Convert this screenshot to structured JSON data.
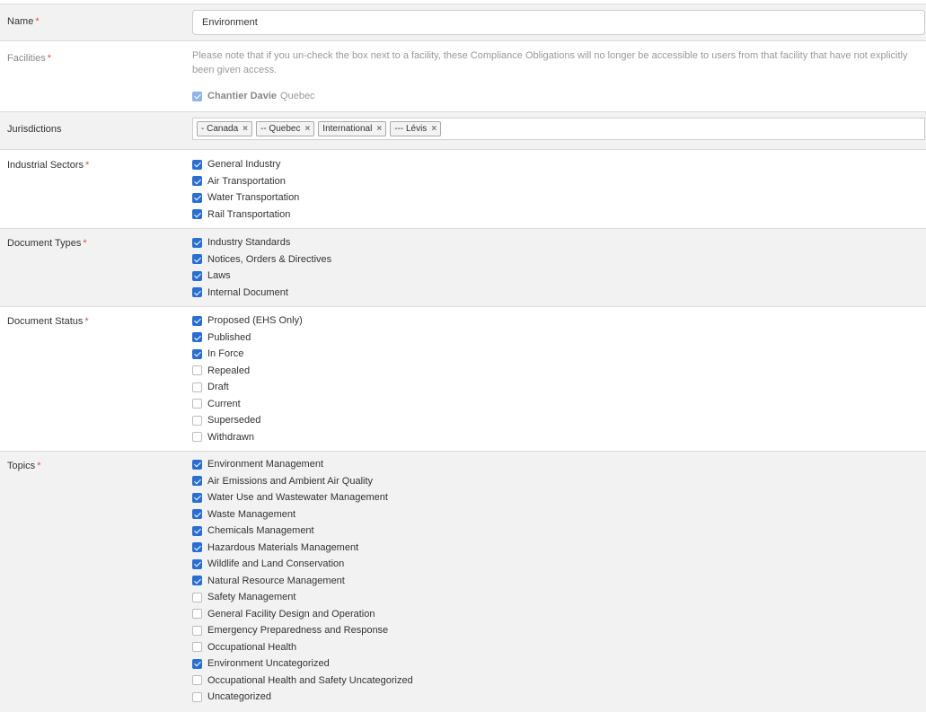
{
  "name": {
    "label": "Name",
    "required": "*",
    "value": "Environment"
  },
  "facilities": {
    "label": "Facilities",
    "required": "*",
    "note": "Please note that if you un-check the box next to a facility, these Compliance Obligations will no longer be accessible to users from that facility that have not explicitly been given access.",
    "items": [
      {
        "name": "Chantier Davie",
        "region": "Quebec",
        "checked": true
      }
    ]
  },
  "jurisdictions": {
    "label": "Jurisdictions",
    "tags": [
      "- Canada",
      "-- Quebec",
      "International",
      "--- Lévis"
    ],
    "remove_glyph": "×"
  },
  "industrial_sectors": {
    "label": "Industrial Sectors",
    "required": "*",
    "items": [
      {
        "label": "General Industry",
        "checked": true
      },
      {
        "label": "Air Transportation",
        "checked": true
      },
      {
        "label": "Water Transportation",
        "checked": true
      },
      {
        "label": "Rail Transportation",
        "checked": true
      }
    ]
  },
  "document_types": {
    "label": "Document Types",
    "required": "*",
    "items": [
      {
        "label": "Industry Standards",
        "checked": true
      },
      {
        "label": "Notices, Orders & Directives",
        "checked": true
      },
      {
        "label": "Laws",
        "checked": true
      },
      {
        "label": "Internal Document",
        "checked": true
      }
    ]
  },
  "document_status": {
    "label": "Document Status",
    "required": "*",
    "items": [
      {
        "label": "Proposed (EHS Only)",
        "checked": true
      },
      {
        "label": "Published",
        "checked": true
      },
      {
        "label": "In Force",
        "checked": true
      },
      {
        "label": "Repealed",
        "checked": false
      },
      {
        "label": "Draft",
        "checked": false
      },
      {
        "label": "Current",
        "checked": false
      },
      {
        "label": "Superseded",
        "checked": false
      },
      {
        "label": "Withdrawn",
        "checked": false
      }
    ]
  },
  "topics": {
    "label": "Topics",
    "required": "*",
    "items": [
      {
        "label": "Environment Management",
        "checked": true
      },
      {
        "label": "Air Emissions and Ambient Air Quality",
        "checked": true
      },
      {
        "label": "Water Use and Wastewater Management",
        "checked": true
      },
      {
        "label": "Waste Management",
        "checked": true
      },
      {
        "label": "Chemicals Management",
        "checked": true
      },
      {
        "label": "Hazardous Materials Management",
        "checked": true
      },
      {
        "label": "Wildlife and Land Conservation",
        "checked": true
      },
      {
        "label": "Natural Resource Management",
        "checked": true
      },
      {
        "label": "Safety Management",
        "checked": false
      },
      {
        "label": "General Facility Design and Operation",
        "checked": false
      },
      {
        "label": "Emergency Preparedness and Response",
        "checked": false
      },
      {
        "label": "Occupational Health",
        "checked": false
      },
      {
        "label": "Environment Uncategorized",
        "checked": true
      },
      {
        "label": "Occupational Health and Safety Uncategorized",
        "checked": false
      },
      {
        "label": "Uncategorized",
        "checked": false
      }
    ]
  },
  "colors": {
    "accent": "#2a6fd0",
    "required": "#d9534f",
    "row_alt": "#f2f2f2"
  }
}
